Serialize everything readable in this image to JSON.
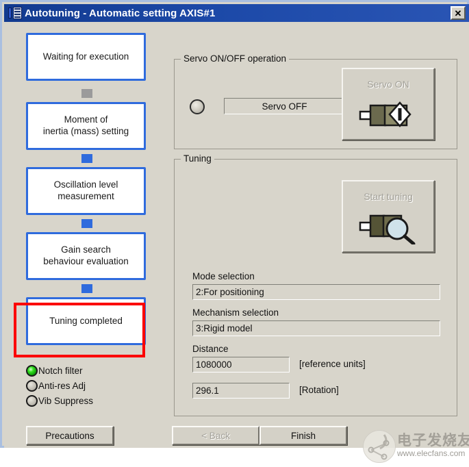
{
  "window": {
    "title": "Autotuning - Automatic setting AXIS#1",
    "icon": "app-icon",
    "close_label": "✕",
    "background_color": "#d8d5cb",
    "titlebar_color": "#1c49a8"
  },
  "flow": {
    "highlight_color": "#fb0000",
    "box_border_color": "#2f6bdd",
    "steps": [
      {
        "label": "Waiting for execution",
        "highlighted": false
      },
      {
        "label": "Moment of\ninertia (mass) setting",
        "highlighted": false
      },
      {
        "label": "Oscillation level\nmeasurement",
        "highlighted": false
      },
      {
        "label": "Gain search\nbehaviour evaluation",
        "highlighted": false
      },
      {
        "label": "Tuning completed",
        "highlighted": true
      }
    ],
    "connectors": [
      "gray",
      "blue",
      "blue",
      "blue"
    ]
  },
  "indicators": [
    {
      "label": "Notch filter",
      "state": "on",
      "color": "#34e020"
    },
    {
      "label": "Anti-res Adj",
      "state": "off",
      "color": "#cac7bd"
    },
    {
      "label": "Vib Suppress",
      "state": "off",
      "color": "#cac7bd"
    }
  ],
  "servo_group": {
    "title": "Servo ON/OFF operation",
    "status_led": "off",
    "status_text": "Servo OFF",
    "button": {
      "label": "Servo ON",
      "icon": "servo-motor-power-icon",
      "enabled": false
    }
  },
  "tuning_group": {
    "title": "Tuning",
    "button": {
      "label": "Start tuning",
      "icon": "servo-motor-magnifier-icon",
      "enabled": false
    },
    "fields": [
      {
        "label": "Mode selection",
        "value": "2:For positioning",
        "unit": ""
      },
      {
        "label": "Mechanism selection",
        "value": "3:Rigid model",
        "unit": ""
      },
      {
        "label": "Distance",
        "value": "1080000",
        "unit": "[reference units]"
      },
      {
        "label": "",
        "value": "296.1",
        "unit": "[Rotation]"
      }
    ]
  },
  "footer": {
    "precautions_label": "Precautions",
    "back_label": "< Back",
    "back_enabled": false,
    "finish_label": "Finish",
    "finish_enabled": true
  },
  "watermark": {
    "text_cn": "电子发烧友",
    "url": "www.elecfans.com"
  }
}
